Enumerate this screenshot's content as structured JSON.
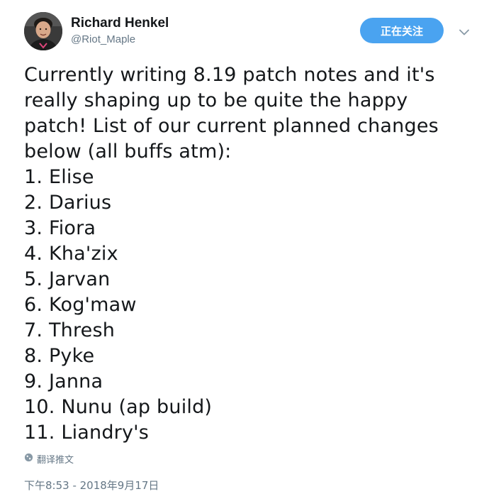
{
  "author": {
    "name": "Richard Henkel",
    "handle": "@Riot_Maple"
  },
  "follow_button": {
    "label": "正在关注"
  },
  "tweet": {
    "lines": [
      "Currently writing 8.19 patch notes and it's",
      "really shaping up to be quite the happy",
      "patch! List of our current planned changes",
      "below (all buffs atm):",
      "1. Elise",
      "2. Darius",
      "3. Fiora",
      "4. Kha'zix",
      "5. Jarvan",
      "6. Kog'maw",
      "7. Thresh",
      "8. Pyke",
      "9. Janna",
      "10. Nunu (ap build)",
      "11. Liandry's"
    ]
  },
  "translate": {
    "label": "翻译推文",
    "icon": "globe-icon"
  },
  "timestamp": "下午8:53 - 2018年9月17日",
  "colors": {
    "follow_button_bg": "#4aa3f0",
    "secondary_text": "#657786",
    "primary_text": "#14171a"
  }
}
